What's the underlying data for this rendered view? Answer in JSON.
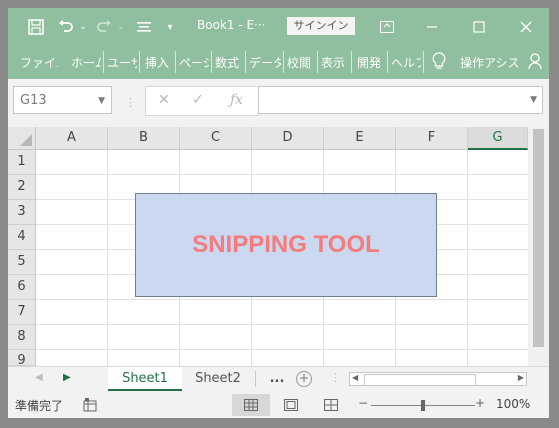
{
  "titlebar": {
    "title": "Book1 - E···",
    "signin": "サインイン",
    "icons": [
      "save-icon",
      "undo-icon",
      "redo-icon",
      "touch-mode-icon",
      "customize-qat-icon",
      "ribbon-display-icon",
      "minimize-icon",
      "maximize-icon",
      "close-icon"
    ]
  },
  "ribbon": {
    "tabs": [
      "ファイル",
      "ホーム",
      "ユーザー",
      "挿入",
      "ページ",
      "数式",
      "データ",
      "校閲",
      "表示",
      "開発",
      "ヘルプ"
    ],
    "tell_me": "操作アシス"
  },
  "formula_bar": {
    "name_box": "G13",
    "formula": ""
  },
  "sheet": {
    "columns": [
      "A",
      "B",
      "C",
      "D",
      "E",
      "F",
      "G"
    ],
    "selected_column": "G",
    "rows": [
      "1",
      "2",
      "3",
      "4",
      "5",
      "6",
      "7",
      "8",
      "9"
    ],
    "shape_text": "SNIPPING TOOL"
  },
  "sheet_tabs": {
    "tabs": [
      "Sheet1",
      "Sheet2"
    ],
    "active": "Sheet1",
    "more": "..."
  },
  "status": {
    "text": "準備完了",
    "zoom_minus": "−",
    "zoom_plus": "+",
    "zoom": "100%"
  },
  "colors": {
    "accent": "#217346",
    "titlebar": "#8fbf9e",
    "shape_fill": "#cbd8ef",
    "shape_text": "#f47c7c"
  }
}
